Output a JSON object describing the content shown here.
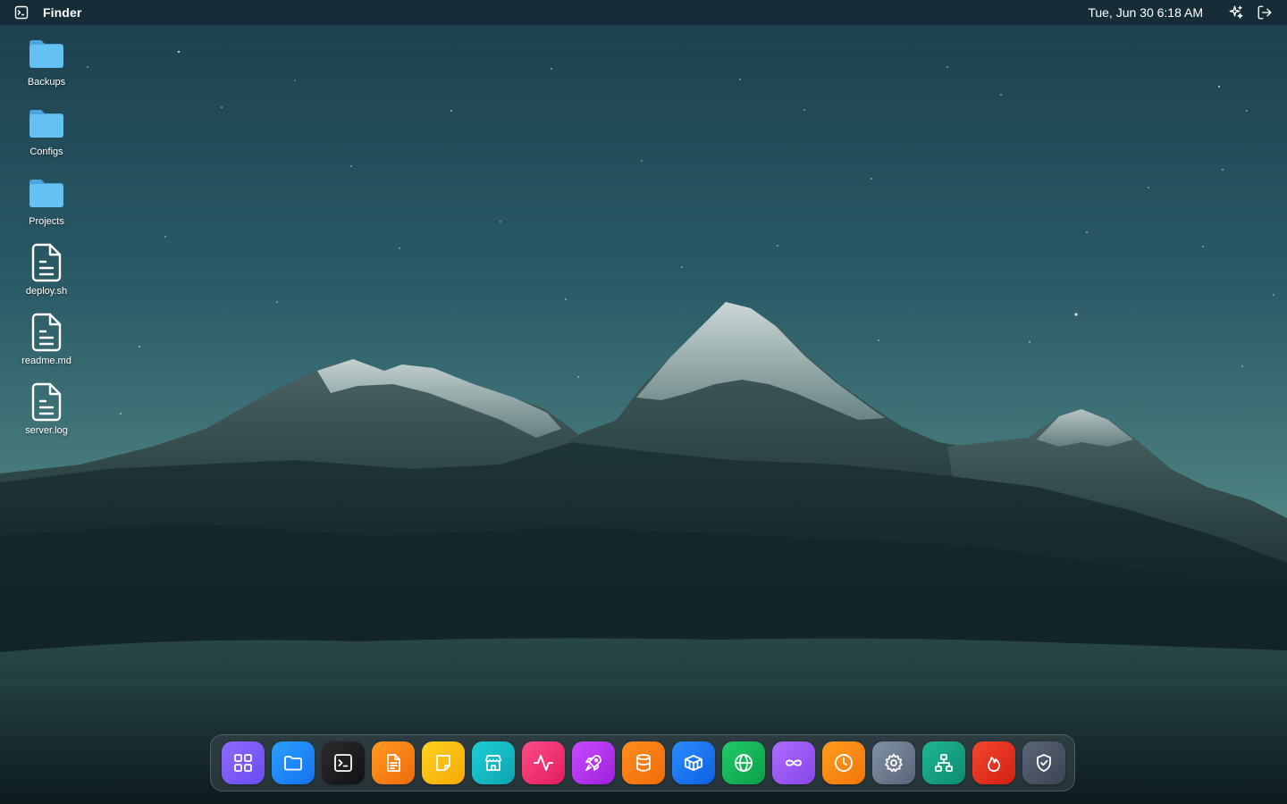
{
  "menubar": {
    "app_name": "Finder",
    "clock": "Tue, Jun 30 6:18 AM",
    "icons": [
      "terminal-square-icon",
      "sparkles-icon",
      "logout-icon"
    ]
  },
  "desktop": {
    "items": [
      {
        "label": "Backups",
        "icon": "folder-icon"
      },
      {
        "label": "Configs",
        "icon": "folder-icon"
      },
      {
        "label": "Projects",
        "icon": "folder-icon"
      },
      {
        "label": "deploy.sh",
        "icon": "file-text-icon"
      },
      {
        "label": "readme.md",
        "icon": "file-text-icon"
      },
      {
        "label": "server.log",
        "icon": "file-text-icon"
      }
    ]
  },
  "dock": {
    "items": [
      {
        "icon": "grid-icon",
        "color": "#7c5cf5"
      },
      {
        "icon": "folder-icon",
        "color": "#1e8cff"
      },
      {
        "icon": "terminal-icon",
        "color": "#1c1c1e"
      },
      {
        "icon": "document-icon",
        "color": "#f57f14"
      },
      {
        "icon": "note-icon",
        "color": "#fdbd10"
      },
      {
        "icon": "store-icon",
        "color": "#14b8c4"
      },
      {
        "icon": "activity-icon",
        "color": "#ef2f6e"
      },
      {
        "icon": "rocket-icon",
        "color": "#b530e8"
      },
      {
        "icon": "database-icon",
        "color": "#fb7a0c"
      },
      {
        "icon": "box-icon",
        "color": "#1a78f2"
      },
      {
        "icon": "globe-icon",
        "color": "#12b55a"
      },
      {
        "icon": "infinity-icon",
        "color": "#9b59f0"
      },
      {
        "icon": "clock-icon",
        "color": "#fb8a0c"
      },
      {
        "icon": "settings-icon",
        "color": "#6b7789"
      },
      {
        "icon": "network-icon",
        "color": "#14a083"
      },
      {
        "icon": "flame-icon",
        "color": "#e5331f"
      },
      {
        "icon": "shield-icon",
        "color": "#4a5465"
      }
    ]
  },
  "colors": {
    "folder": "#5bb8f0",
    "sky_top": "#1c3f4c",
    "sky_horizon": "#5b8f88",
    "mountain_dark": "#14282b"
  }
}
